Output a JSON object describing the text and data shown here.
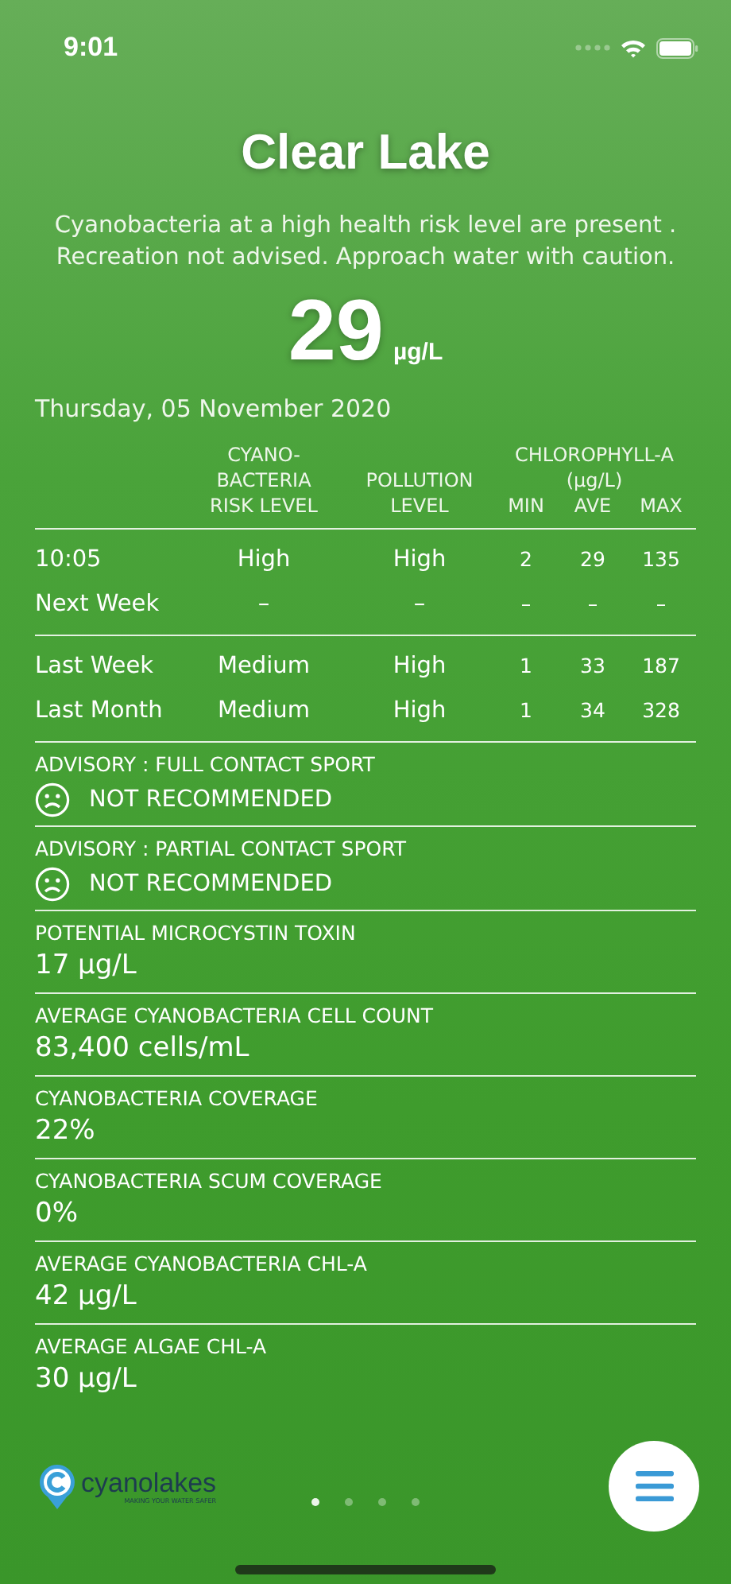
{
  "status_bar": {
    "time": "9:01"
  },
  "title": "Clear Lake",
  "description": "Cyanobacteria at a high health risk level are present  . Recreation not advised. Approach water with caution.",
  "reading": {
    "value": "29",
    "unit": "µg/L"
  },
  "date": "Thursday, 05 November 2020",
  "table": {
    "columns": [
      "",
      "CYANO-\nBACTERIA\nRISK LEVEL",
      "POLLUTION\nLEVEL"
    ],
    "group_heading": "CHLOROPHYLL-A\n(µg/L)",
    "subcolumns": [
      "MIN",
      "AVE",
      "MAX"
    ],
    "groups": [
      {
        "rows": [
          [
            "10:05",
            "High",
            "High",
            "2",
            "29",
            "135"
          ],
          [
            "Next Week",
            "–",
            "–",
            "–",
            "–",
            "–"
          ]
        ]
      },
      {
        "rows": [
          [
            "Last Week",
            "Medium",
            "High",
            "1",
            "33",
            "187"
          ],
          [
            "Last Month",
            "Medium",
            "High",
            "1",
            "34",
            "328"
          ]
        ]
      }
    ]
  },
  "sections": [
    {
      "kind": "advisory",
      "label": "ADVISORY : FULL CONTACT SPORT",
      "value": "NOT RECOMMENDED"
    },
    {
      "kind": "advisory",
      "label": "ADVISORY : PARTIAL CONTACT SPORT",
      "value": "NOT RECOMMENDED"
    },
    {
      "kind": "metric",
      "label": "POTENTIAL MICROCYSTIN TOXIN",
      "value": "17 µg/L"
    },
    {
      "kind": "metric",
      "label": "AVERAGE CYANOBACTERIA CELL COUNT",
      "value": "83,400 cells/mL"
    },
    {
      "kind": "metric",
      "label": "CYANOBACTERIA COVERAGE",
      "value": "22%"
    },
    {
      "kind": "metric",
      "label": "CYANOBACTERIA SCUM COVERAGE",
      "value": "0%"
    },
    {
      "kind": "metric",
      "label": "AVERAGE CYANOBACTERIA CHL-A",
      "value": "42 µg/L"
    },
    {
      "kind": "metric",
      "label": "AVERAGE ALGAE CHL-A",
      "value": "30 µg/L"
    }
  ],
  "logo": {
    "name": "cyanolakes",
    "tagline": "MAKING YOUR WATER SAFER"
  },
  "pages": [
    {
      "selected": true
    },
    {
      "selected": false
    },
    {
      "selected": false
    },
    {
      "selected": false
    }
  ]
}
